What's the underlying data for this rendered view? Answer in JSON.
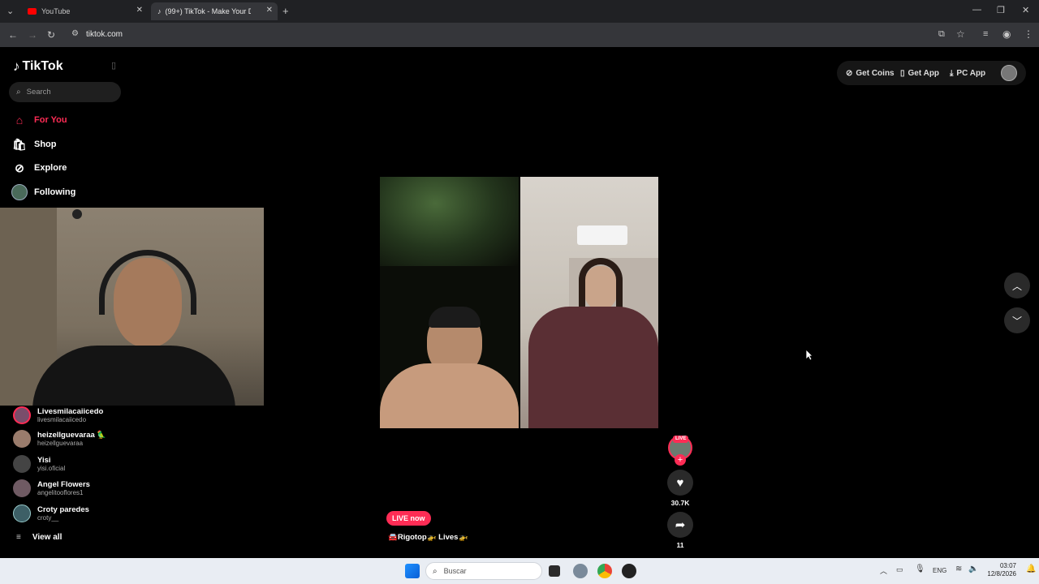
{
  "browser": {
    "tabs": [
      {
        "title": "YouTube"
      },
      {
        "title": "(99+) TikTok - Make Your Day"
      }
    ],
    "url": "tiktok.com"
  },
  "tiktok": {
    "logo": "TikTok",
    "search_placeholder": "Search",
    "nav": [
      {
        "label": "For You",
        "icon": "home-icon",
        "active": true
      },
      {
        "label": "Shop",
        "icon": "shop-icon"
      },
      {
        "label": "Explore",
        "icon": "compass-icon"
      },
      {
        "label": "Following",
        "icon": "following-icon"
      }
    ],
    "accounts": [
      {
        "name": "Livesmilacaiicedo",
        "handle": "livesmilacaiicedo",
        "live": true
      },
      {
        "name": "heizellguevaraa 🦜",
        "handle": "heizellguevaraa"
      },
      {
        "name": "Yisi",
        "handle": "yisi.oficial"
      },
      {
        "name": "Angel Flowers",
        "handle": "angelitooflores1"
      },
      {
        "name": "Croty paredes",
        "handle": "croty__"
      }
    ],
    "view_all": "View all",
    "top_actions": {
      "get_coins": "Get Coins",
      "get_app": "Get App",
      "pc_app": "PC App"
    },
    "live_badge": "LIVE now",
    "video_caption": "🚘Rigotop🚁 Lives🚁",
    "creator_live_tag": "LIVE",
    "likes": "30.7K",
    "shares": "11"
  },
  "taskbar": {
    "search_placeholder": "Buscar",
    "lang": "ENG",
    "time": "03:07",
    "date": "12/8/2026"
  },
  "colors": {
    "brand": "#fe2c55",
    "bg": "#000000"
  }
}
